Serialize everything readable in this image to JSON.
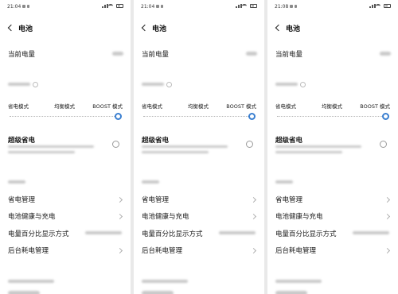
{
  "panels": [
    {
      "status": {
        "time": "21:04"
      },
      "header": {
        "title": "电池",
        "back_icon": "chevron-left-icon"
      },
      "current_charge": {
        "label": "当前电量"
      },
      "modes": {
        "options": [
          "省电模式",
          "均衡模式",
          "BOOST 模式"
        ],
        "selected_index": 2
      },
      "super_saver": {
        "label": "超级省电",
        "enabled": false
      },
      "menu": [
        {
          "label": "省电管理"
        },
        {
          "label": "电池健康与充电"
        },
        {
          "label": "电量百分比显示方式"
        },
        {
          "label": "后台耗电管理"
        }
      ]
    },
    {
      "status": {
        "time": "21:04"
      },
      "header": {
        "title": "电池",
        "back_icon": "chevron-left-icon"
      },
      "current_charge": {
        "label": "当前电量"
      },
      "modes": {
        "options": [
          "省电模式",
          "均衡模式",
          "BOOST 模式"
        ],
        "selected_index": 2
      },
      "super_saver": {
        "label": "超级省电",
        "enabled": false
      },
      "menu": [
        {
          "label": "省电管理"
        },
        {
          "label": "电池健康与充电"
        },
        {
          "label": "电量百分比显示方式"
        },
        {
          "label": "后台耗电管理"
        }
      ]
    },
    {
      "status": {
        "time": "21:08"
      },
      "header": {
        "title": "电池",
        "back_icon": "chevron-left-icon"
      },
      "current_charge": {
        "label": "当前电量"
      },
      "modes": {
        "options": [
          "省电模式",
          "均衡模式",
          "BOOST 模式"
        ],
        "selected_index": 2
      },
      "super_saver": {
        "label": "超级省电",
        "enabled": false
      },
      "menu": [
        {
          "label": "省电管理"
        },
        {
          "label": "电池健康与充电"
        },
        {
          "label": "电量百分比显示方式"
        },
        {
          "label": "后台耗电管理"
        }
      ]
    }
  ],
  "colors": {
    "accent": "#3a7fd0",
    "text": "#1a1a1a",
    "secondary": "#9a9a9a",
    "background": "#ffffff"
  }
}
